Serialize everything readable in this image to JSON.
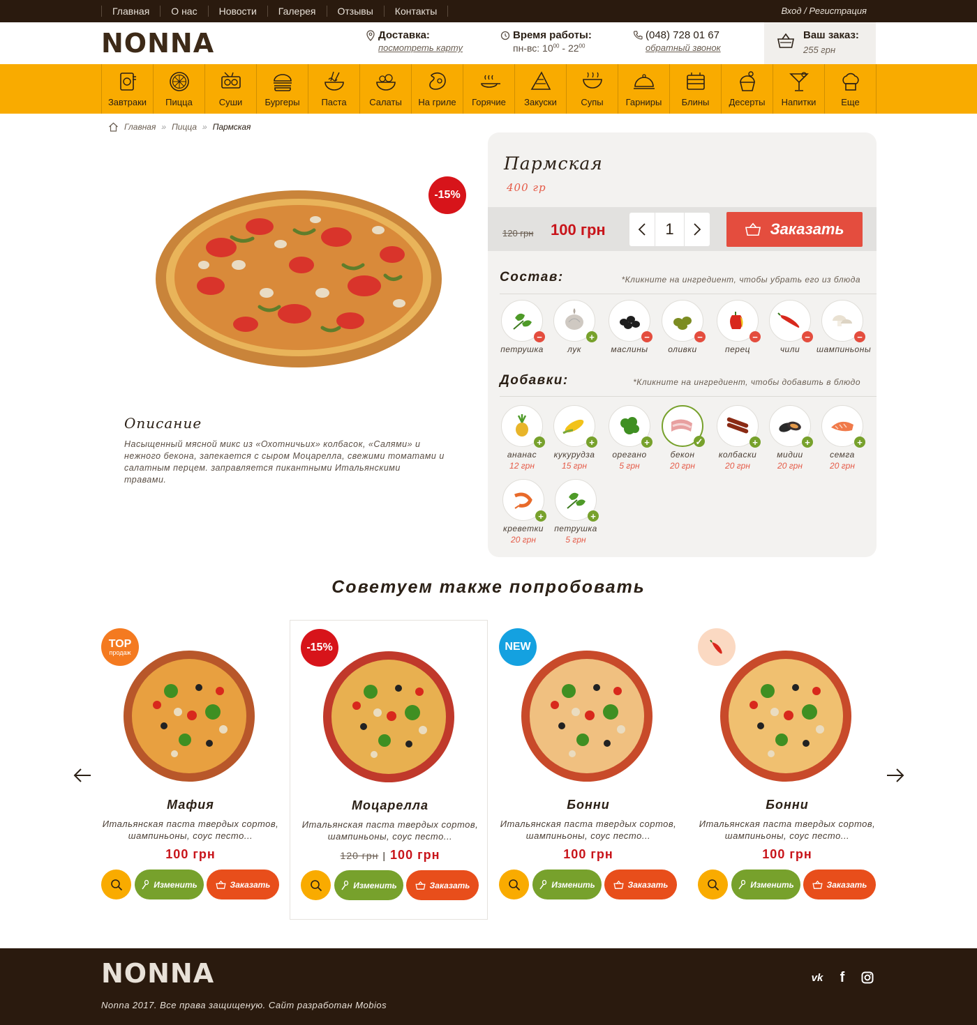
{
  "topnav": {
    "items": [
      "Главная",
      "О нас",
      "Новости",
      "Галерея",
      "Отзывы",
      "Контакты"
    ],
    "login": "Вход / Регистрация"
  },
  "header": {
    "logo": "NONNA",
    "delivery": {
      "title": "Доставка:",
      "link": "посмотреть карту"
    },
    "hours": {
      "title": "Время работы:",
      "days": "пн-вс: 10",
      "from_sup": "00",
      "dash": " - 22",
      "to_sup": "00"
    },
    "phone": {
      "number": "(048) 728 01 67",
      "link": "обратный звонок"
    },
    "cart": {
      "title": "Ваш заказ:",
      "sum": "255 грн"
    }
  },
  "categories": [
    {
      "label": "Завтраки",
      "icon": "breakfast-icon"
    },
    {
      "label": "Пицца",
      "icon": "pizza-icon"
    },
    {
      "label": "Суши",
      "icon": "sushi-icon"
    },
    {
      "label": "Бургеры",
      "icon": "burger-icon"
    },
    {
      "label": "Паста",
      "icon": "pasta-icon"
    },
    {
      "label": "Салаты",
      "icon": "salad-icon"
    },
    {
      "label": "На гриле",
      "icon": "grill-icon"
    },
    {
      "label": "Горячие",
      "icon": "hot-dish-icon"
    },
    {
      "label": "Закуски",
      "icon": "snack-icon"
    },
    {
      "label": "Супы",
      "icon": "soup-icon"
    },
    {
      "label": "Гарниры",
      "icon": "cloche-icon"
    },
    {
      "label": "Блины",
      "icon": "pancake-icon"
    },
    {
      "label": "Десерты",
      "icon": "dessert-icon"
    },
    {
      "label": "Напитки",
      "icon": "cocktail-icon"
    },
    {
      "label": "Еще",
      "icon": "chef-hat-icon"
    }
  ],
  "breadcrumb": [
    "Главная",
    "Пицца",
    "Пармская"
  ],
  "product": {
    "discount": "-15%",
    "title": "Пармская",
    "weight": "400 гр",
    "old_price": "120 грн",
    "price": "100 грн",
    "quantity": "1",
    "order_label": "Заказать",
    "desc_title": "Описание",
    "description": "Насыщенный мясной микс из «Охотничьих» колбасок, «Салями» и нежного бекона, запекается с сыром Моцарелла, свежими томатами и салатным перцем. заправляется пикантными Итальянскими травами."
  },
  "composition": {
    "title": "Состав:",
    "hint": "*Кликните на ингредиент, чтобы убрать его из блюда",
    "items": [
      {
        "name": "петрушка",
        "mark": "minus",
        "icon": "parsley-icon"
      },
      {
        "name": "лук",
        "mark": "plus",
        "icon": "onion-icon"
      },
      {
        "name": "маслины",
        "mark": "minus",
        "icon": "black-olives-icon"
      },
      {
        "name": "оливки",
        "mark": "minus",
        "icon": "green-olives-icon"
      },
      {
        "name": "перец",
        "mark": "minus",
        "icon": "pepper-icon"
      },
      {
        "name": "чили",
        "mark": "minus",
        "icon": "chili-icon"
      },
      {
        "name": "шампиньоны",
        "mark": "minus",
        "icon": "mushroom-icon"
      }
    ]
  },
  "additions": {
    "title": "Добавки:",
    "hint": "*Кликните на ингредиент, чтобы добавить в блюдо",
    "items": [
      {
        "name": "ананас",
        "price": "12 грн",
        "icon": "pineapple-icon"
      },
      {
        "name": "кукурудза",
        "price": "15 грн",
        "icon": "corn-icon"
      },
      {
        "name": "орегано",
        "price": "5 грн",
        "icon": "oregano-icon"
      },
      {
        "name": "бекон",
        "price": "20 грн",
        "icon": "bacon-icon",
        "selected": true
      },
      {
        "name": "колбаски",
        "price": "20 грн",
        "icon": "sausage-icon"
      },
      {
        "name": "мидии",
        "price": "20 грн",
        "icon": "mussel-icon"
      },
      {
        "name": "семга",
        "price": "20 грн",
        "icon": "salmon-icon"
      },
      {
        "name": "креветки",
        "price": "20 грн",
        "icon": "shrimp-icon"
      },
      {
        "name": "петрушка",
        "price": "5 грн",
        "icon": "parsley-icon"
      }
    ]
  },
  "recommend": {
    "title": "Советуем также попробовать",
    "items": [
      {
        "name": "Мафия",
        "desc": "Итальянская паста твердых сортов, шампиньоны, соус песто...",
        "price": "100 грн",
        "badge": "TOP",
        "badge_sub": "продаж",
        "badge_color": "#f47a20"
      },
      {
        "name": "Моцарелла",
        "desc": "Итальянская паста твердых сортов, шампиньоны, соус песто...",
        "price": "100 грн",
        "old_price": "120 грн",
        "badge": "-15%",
        "badge_color": "#d7141a"
      },
      {
        "name": "Бонни",
        "desc": "Итальянская паста твердых сортов, шампиньоны, соус песто...",
        "price": "100 грн",
        "badge": "NEW",
        "badge_color": "#14a1e0"
      },
      {
        "name": "Бонни",
        "desc": "Итальянская паста твердых сортов, шампиньоны, соус песто...",
        "price": "100 грн",
        "badge": "",
        "badge_color": "#fbd9c2"
      }
    ],
    "edit_label": "Изменить",
    "order_label": "Заказать"
  },
  "footer": {
    "logo": "NONNA",
    "copyright": "Nonna 2017. Все права защищеную. Сайт разработан Mobios",
    "social": [
      "vk-icon",
      "facebook-icon",
      "instagram-icon"
    ]
  },
  "colors": {
    "brown": "#2a1a0e",
    "orange": "#f9ab00",
    "red": "#e44d3e",
    "green": "#77a12c",
    "price_red": "#c8141a"
  }
}
